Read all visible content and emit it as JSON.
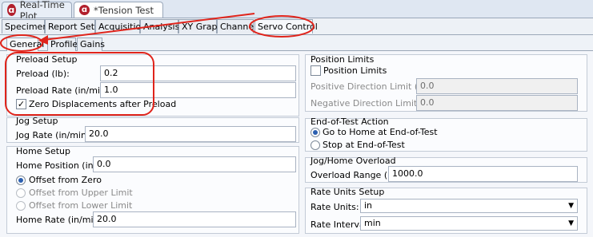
{
  "editor_tabs": {
    "realtime": {
      "label": "Real-Time Plot",
      "close": "✕"
    },
    "tension": {
      "label": "*Tension Test"
    }
  },
  "main_tabs": [
    "Specimen",
    "Report Setup",
    "Acquisition",
    "Analysis",
    "XY Graph",
    "Channels",
    "Servo Control"
  ],
  "sub_tabs": [
    "General",
    "Profile",
    "Gains"
  ],
  "preload_setup": {
    "title": "Preload Setup",
    "preload_label": "Preload (lb):",
    "preload_value": "0.2",
    "rate_label": "Preload Rate (in/min):",
    "rate_value": "1.0",
    "zero_disp_label": "Zero Displacements after Preload",
    "zero_disp_checked": true
  },
  "jog_setup": {
    "title": "Jog Setup",
    "rate_label": "Jog Rate (in/min):",
    "rate_value": "20.0"
  },
  "home_setup": {
    "title": "Home Setup",
    "position_label": "Home Position (in):",
    "position_value": "0.0",
    "options": [
      "Offset from Zero",
      "Offset from Upper Limit",
      "Offset from Lower Limit"
    ],
    "rate_label": "Home Rate (in/min):",
    "rate_value": "20.0"
  },
  "position_limits": {
    "title": "Position Limits",
    "checkbox_label": "Position Limits",
    "positive_label": "Positive Direction Limit (in):",
    "positive_value": "0.0",
    "negative_label": "Negative Direction Limit (in):",
    "negative_value": "0.0"
  },
  "end_of_test": {
    "title": "End-of-Test Action",
    "options": [
      "Go to Home at End-of-Test",
      "Stop at End-of-Test"
    ]
  },
  "jog_home_overload": {
    "title": "Jog/Home Overload",
    "range_label": "Overload Range (lb):",
    "range_value": "1000.0"
  },
  "rate_units": {
    "title": "Rate Units Setup",
    "units_label": "Rate Units:",
    "units_value": "in",
    "interval_label": "Rate Interval:",
    "interval_value": "min"
  },
  "colors": {
    "annotation_red": "#e0241b",
    "selection_blue": "#2b5fb0"
  }
}
